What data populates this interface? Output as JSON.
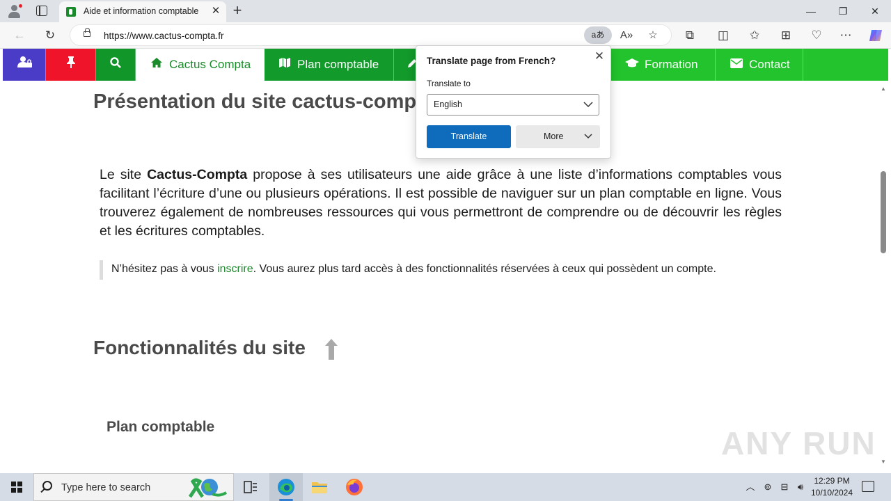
{
  "browser": {
    "tab_title": "Aide et information comptable",
    "url": "https://www.cactus-compta.fr",
    "translate_pill": "aあ"
  },
  "site_nav": {
    "home_label": "Cactus Compta",
    "plan_label": "Plan comptable",
    "formation_label": "Formation",
    "contact_label": "Contact",
    "colors": {
      "nav_green": "#22c32c",
      "user_purple": "#4b3cc8",
      "pin_red": "#f0142a",
      "dark_green": "#129a2b"
    }
  },
  "page": {
    "heading": "Présentation du site cactus-comp",
    "intro_prefix": "Le site ",
    "intro_bold": "Cactus-Compta",
    "intro_rest": " propose à ses utilisateurs une aide grâce à une liste d’informations comptables vous facilitant l’écriture d’une ou plusieurs opérations. Il est possible de naviguer sur un plan comptable en ligne. Vous trouverez également de nombreuses ressources qui vous permettront de comprendre ou de découvrir les règles et les écritures comptables.",
    "note_prefix": "N’hésitez pas à vous ",
    "note_link": "inscrire",
    "note_suffix": ". Vous aurez plus tard accès à des fonctionnalités réservées à ceux qui possèdent un compte.",
    "section_heading": "Fonctionnalités du site",
    "subsection_heading": "Plan comptable",
    "watermark": "ANY RUN"
  },
  "translate_popup": {
    "title": "Translate page from French?",
    "label": "Translate to",
    "language": "English",
    "translate_button": "Translate",
    "more_button": "More"
  },
  "taskbar": {
    "search_placeholder": "Type here to search",
    "time": "12:29 PM",
    "date": "10/10/2024"
  }
}
